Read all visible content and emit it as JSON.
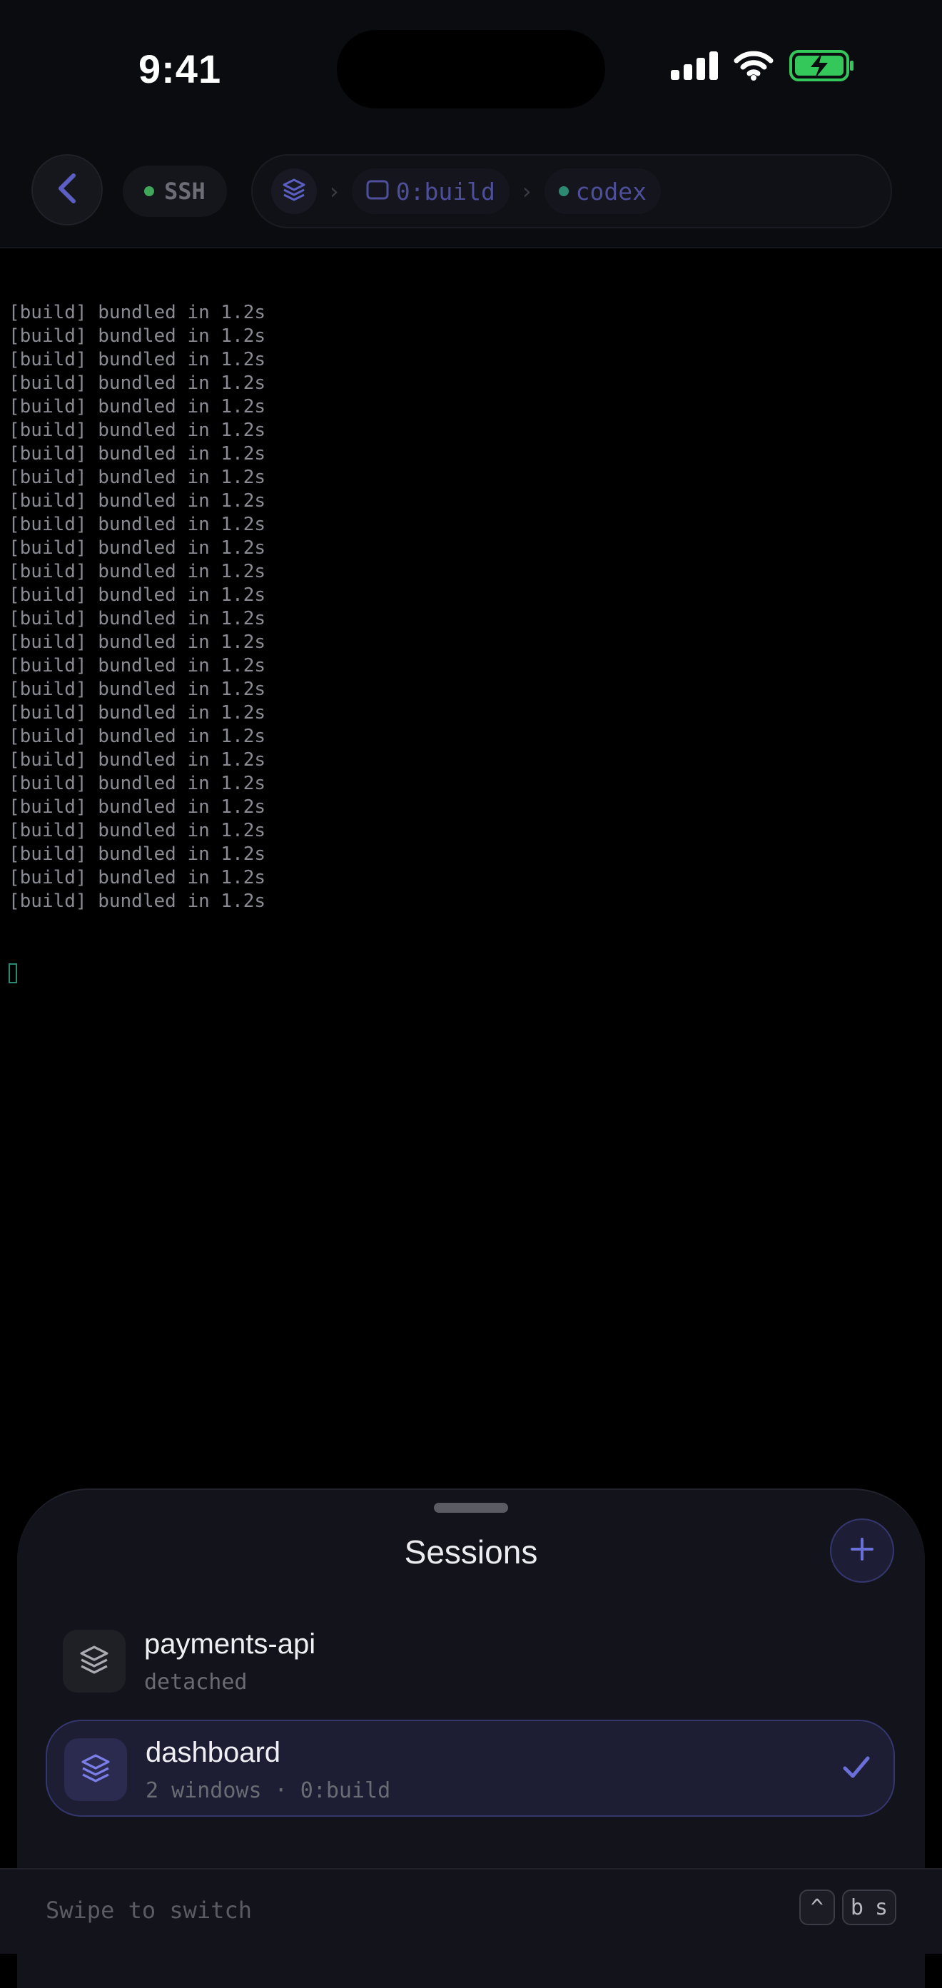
{
  "status_bar": {
    "time": "9:41"
  },
  "toolbar": {
    "connection_label": "SSH",
    "breadcrumb": {
      "window": "0:build",
      "pane": "codex"
    }
  },
  "terminal": {
    "lines": [
      "[build] bundled in 1.2s",
      "[build] bundled in 1.2s",
      "[build] bundled in 1.2s",
      "[build] bundled in 1.2s",
      "[build] bundled in 1.2s",
      "[build] bundled in 1.2s",
      "[build] bundled in 1.2s",
      "[build] bundled in 1.2s",
      "[build] bundled in 1.2s",
      "[build] bundled in 1.2s",
      "[build] bundled in 1.2s",
      "[build] bundled in 1.2s",
      "[build] bundled in 1.2s",
      "[build] bundled in 1.2s",
      "[build] bundled in 1.2s",
      "[build] bundled in 1.2s",
      "[build] bundled in 1.2s",
      "[build] bundled in 1.2s",
      "[build] bundled in 1.2s",
      "[build] bundled in 1.2s",
      "[build] bundled in 1.2s",
      "[build] bundled in 1.2s",
      "[build] bundled in 1.2s",
      "[build] bundled in 1.2s",
      "[build] bundled in 1.2s",
      "[build] bundled in 1.2s"
    ]
  },
  "sessions_sheet": {
    "title": "Sessions",
    "sessions": [
      {
        "name": "payments-api",
        "subtitle": "detached",
        "active": false
      },
      {
        "name": "dashboard",
        "subtitle": "2 windows · 0:build",
        "active": true
      }
    ],
    "footer_hint": "Swipe to switch",
    "shortcut_keys": [
      "^",
      "b",
      "s"
    ]
  },
  "colors": {
    "accent": "#6b6fd8",
    "connected_green": "#3fa65a",
    "pane_teal": "#2d8a72",
    "battery_green": "#34c759"
  }
}
